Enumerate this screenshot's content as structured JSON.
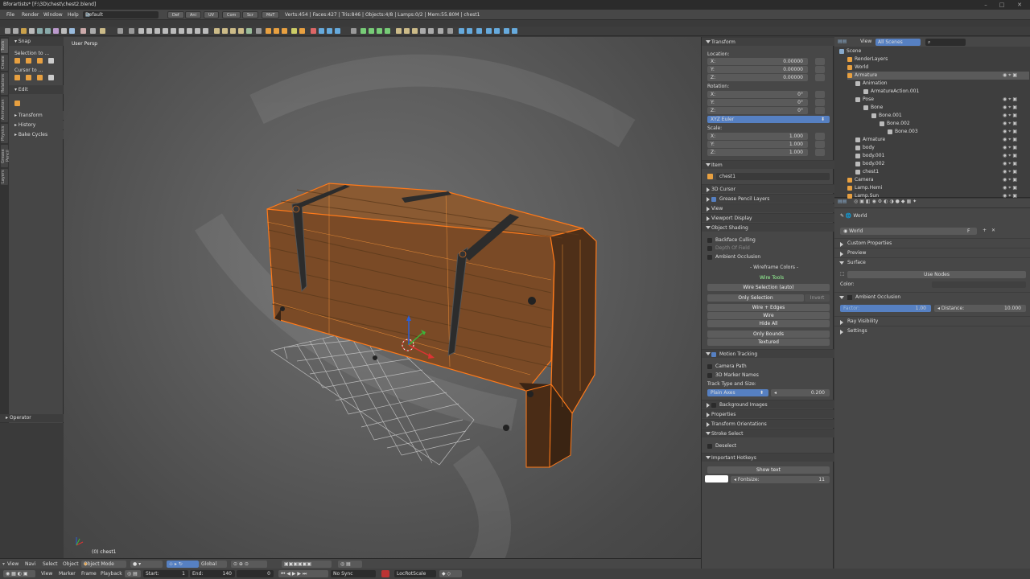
{
  "window": {
    "title": "Bforartists* [F:\\3D\\chest\\chest2.blend]"
  },
  "menu": {
    "file": "File",
    "render": "Render",
    "window": "Window",
    "help": "Help",
    "layout": "Default"
  },
  "info": {
    "stats": "Verts:454 | Faces:427 | Tris:846 | Objects:4/8 | Lamps:0/2 | Mem:55.80M | chest1",
    "tabs": [
      "Def",
      "Ani",
      "UV",
      "Com",
      "Scr",
      "MoT"
    ]
  },
  "shelf": {
    "tabs": [
      "Tools",
      "Create",
      "Relations",
      "Animation",
      "Physics",
      "Grease Pencil",
      "Layers"
    ],
    "snap": "Snap",
    "selection_to": "Selection to ...",
    "cursor_to": "Cursor to ...",
    "edit": "Edit",
    "transform": "Transform",
    "history": "History",
    "bake_cycles": "Bake Cycles",
    "operator": "Operator"
  },
  "viewport": {
    "view_name": "User Persp",
    "object_label": "(0) chest1"
  },
  "vp_header": {
    "view": "View",
    "navi": "Navi",
    "select": "Select",
    "object": "Object",
    "mode": "Object Mode",
    "orientation": "Global"
  },
  "timeline": {
    "view": "View",
    "marker": "Marker",
    "frame": "Frame",
    "playback": "Playback",
    "start_label": "Start:",
    "start_value": "1",
    "end_label": "End:",
    "end_value": "140",
    "current": "0",
    "sync": "No Sync",
    "keying": "LocRotScale"
  },
  "npanel": {
    "transform": "Transform",
    "location": "Location:",
    "rotation": "Rotation:",
    "scale": "Scale:",
    "axes": [
      "X:",
      "Y:",
      "Z:"
    ],
    "loc": [
      "0.00000",
      "0.00000",
      "0.00000"
    ],
    "rot": [
      "0°",
      "0°",
      "0°"
    ],
    "rot_mode": "XYZ Euler",
    "scl": [
      "1.000",
      "1.000",
      "1.000"
    ],
    "item": "Item",
    "item_name": "chest1",
    "cursor3d": "3D Cursor",
    "grease_layers": "Grease Pencil Layers",
    "view": "View",
    "viewport_display": "Viewport Display",
    "object_shading": "Object Shading",
    "backface": "Backface Culling",
    "depth_of_field": "Depth Of Field",
    "ao": "Ambient Occlusion",
    "wire_colors": "- Wireframe Colors -",
    "wire_tools": "Wire Tools",
    "wire_sel": "Wire Selection (auto)",
    "only_sel": "Only Selection",
    "invert": "Invert",
    "wire_edges": "Wire + Edges",
    "wire": "Wire",
    "hide_all": "Hide All",
    "only_bounds": "Only Bounds",
    "textured": "Textured",
    "motion_tracking": "Motion Tracking",
    "camera_path": "Camera Path",
    "marker_names": "3D Marker Names",
    "track_type": "Track Type and Size:",
    "plain_axes": "Plain Axes",
    "track_size": "0.200",
    "bg_images": "Background Images",
    "properties": "Properties",
    "transform_orient": "Transform Orientations",
    "stroke_select": "Stroke Select",
    "deselect": "Deselect",
    "hotkeys": "Important Hotkeys",
    "show_text": "Show text",
    "fontsize_label": "Fontsize:",
    "fontsize": "11"
  },
  "outliner": {
    "view": "View",
    "scenes": "All Scenes",
    "items": [
      {
        "label": "Scene",
        "depth": 0
      },
      {
        "label": "RenderLayers",
        "depth": 1
      },
      {
        "label": "World",
        "depth": 1
      },
      {
        "label": "Armature",
        "depth": 1
      },
      {
        "label": "Animation",
        "depth": 2
      },
      {
        "label": "ArmatureAction.001",
        "depth": 3
      },
      {
        "label": "Pose",
        "depth": 2
      },
      {
        "label": "Bone",
        "depth": 3
      },
      {
        "label": "Bone.001",
        "depth": 4
      },
      {
        "label": "Bone.002",
        "depth": 5
      },
      {
        "label": "Bone.003",
        "depth": 6
      },
      {
        "label": "Armature",
        "depth": 2
      },
      {
        "label": "body",
        "depth": 2
      },
      {
        "label": "body.001",
        "depth": 2
      },
      {
        "label": "body.002",
        "depth": 2
      },
      {
        "label": "chest1",
        "depth": 2
      },
      {
        "label": "Camera",
        "depth": 1
      },
      {
        "label": "Lamp.Hemi",
        "depth": 1
      },
      {
        "label": "Lamp.Sun",
        "depth": 1
      }
    ]
  },
  "props": {
    "context": "World",
    "world_name": "World",
    "f_badge": "F",
    "custom_props": "Custom Properties",
    "preview": "Preview",
    "surface": "Surface",
    "use_nodes": "Use Nodes",
    "color": "Color:",
    "ao": "Ambient Occlusion",
    "factor_label": "Factor:",
    "factor": "1.00",
    "distance_label": "Distance:",
    "distance": "10.000",
    "ray_visibility": "Ray Visibility",
    "settings": "Settings"
  },
  "colors": {
    "accent": "#5680c2",
    "selection": "#ff7a1a",
    "wire_green": "#8fe07a"
  }
}
